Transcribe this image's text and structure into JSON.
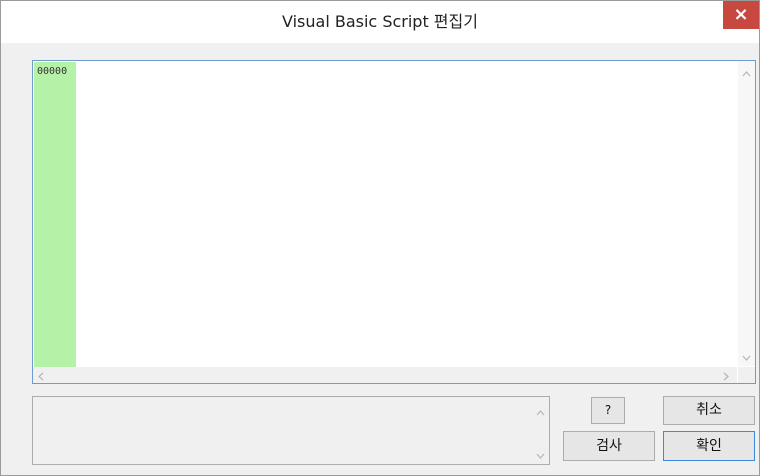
{
  "window": {
    "title": "Visual Basic Script 편집기",
    "close_glyph": "×"
  },
  "editor": {
    "line_numbers": [
      "00000"
    ],
    "code": ""
  },
  "output": {
    "text": ""
  },
  "buttons": {
    "help": "?",
    "cancel": "취소",
    "check": "검사",
    "ok": "확인"
  },
  "icons": {
    "scroll_up": "chevron-up-icon",
    "scroll_down": "chevron-down-icon",
    "scroll_left": "chevron-left-icon",
    "scroll_right": "chevron-right-icon",
    "close": "close-icon"
  },
  "colors": {
    "gutter": "#b5f2a8",
    "close_button": "#c7483f",
    "editor_border": "#6f9bd1",
    "ok_border": "#3c8ae0"
  }
}
